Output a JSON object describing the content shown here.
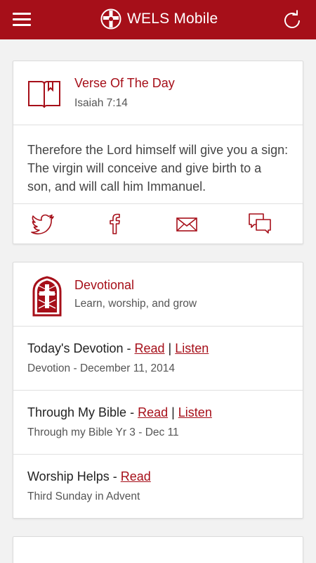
{
  "header": {
    "title": "WELS Mobile",
    "menu_icon": "hamburger-menu-icon",
    "refresh_icon": "refresh-icon",
    "logo_icon": "wels-cross-logo",
    "color": "#a60f19"
  },
  "verse": {
    "title": "Verse Of The Day",
    "reference": "Isaiah 7:14",
    "text": "Therefore the Lord himself will give you a sign: The virgin will conceive and give birth to a son, and will call him Immanuel.",
    "share_icons": [
      "twitter-icon",
      "facebook-icon",
      "mail-icon",
      "chat-icon"
    ]
  },
  "devotional": {
    "title": "Devotional",
    "subtitle": "Learn, worship, and grow",
    "items": [
      {
        "title": "Today's Devotion",
        "sep": " - ",
        "read": "Read",
        "pipe": " | ",
        "listen": "Listen",
        "sub": "Devotion - December 11, 2014"
      },
      {
        "title": "Through My Bible",
        "sep": " - ",
        "read": "Read",
        "pipe": " | ",
        "listen": "Listen",
        "sub": "Through my Bible Yr 3 - Dec 11"
      },
      {
        "title": "Worship Helps",
        "sep": " - ",
        "read": "Read",
        "sub": "Third Sunday in Advent"
      }
    ]
  }
}
